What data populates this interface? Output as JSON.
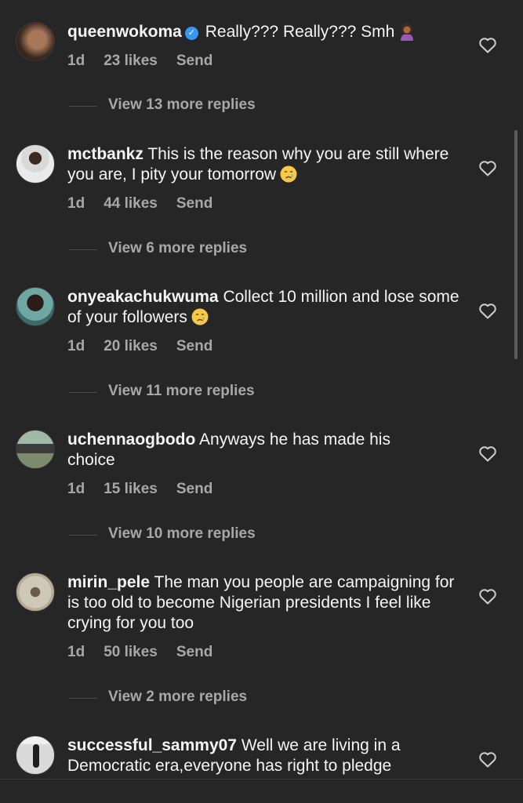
{
  "comments": [
    {
      "username": "queenwokoma",
      "verified": true,
      "text": "Really??? Really??? Smh",
      "emoji": "woman-tipping-hand",
      "time": "1d",
      "likes": "23 likes",
      "send": "Send",
      "replies": "View 13 more replies"
    },
    {
      "username": "mctbankz",
      "verified": false,
      "text": "This is the reason why you are still where you are, I pity your tomorrow",
      "emoji": "crying-face",
      "time": "1d",
      "likes": "44 likes",
      "send": "Send",
      "replies": "View 6 more replies"
    },
    {
      "username": "onyeakachukwuma",
      "verified": false,
      "text": "Collect 10 million and lose some of your followers",
      "emoji": "crying-face",
      "time": "1d",
      "likes": "20 likes",
      "send": "Send",
      "replies": "View 11 more replies"
    },
    {
      "username": "uchennaogbodo",
      "verified": false,
      "text": "Anyways he has made his choice",
      "time": "1d",
      "likes": "15 likes",
      "send": "Send",
      "replies": "View 10 more replies"
    },
    {
      "username": "mirin_pele",
      "verified": false,
      "text": "The man you people are campaigning for is too old to become Nigerian presidents I feel like crying for you too",
      "time": "1d",
      "likes": "50 likes",
      "send": "Send",
      "replies": "View 2 more replies"
    },
    {
      "username": "successful_sammy07",
      "verified": false,
      "text": "Well we are living in a Democratic era,everyone has right to pledge"
    }
  ],
  "icons": {
    "like": "heart-outline-icon",
    "verified": "verified-badge-icon"
  },
  "colors": {
    "background": "#262626",
    "primary_text": "#f5f5f5",
    "secondary_text": "#a8a8a8",
    "verified": "#3897f0"
  }
}
